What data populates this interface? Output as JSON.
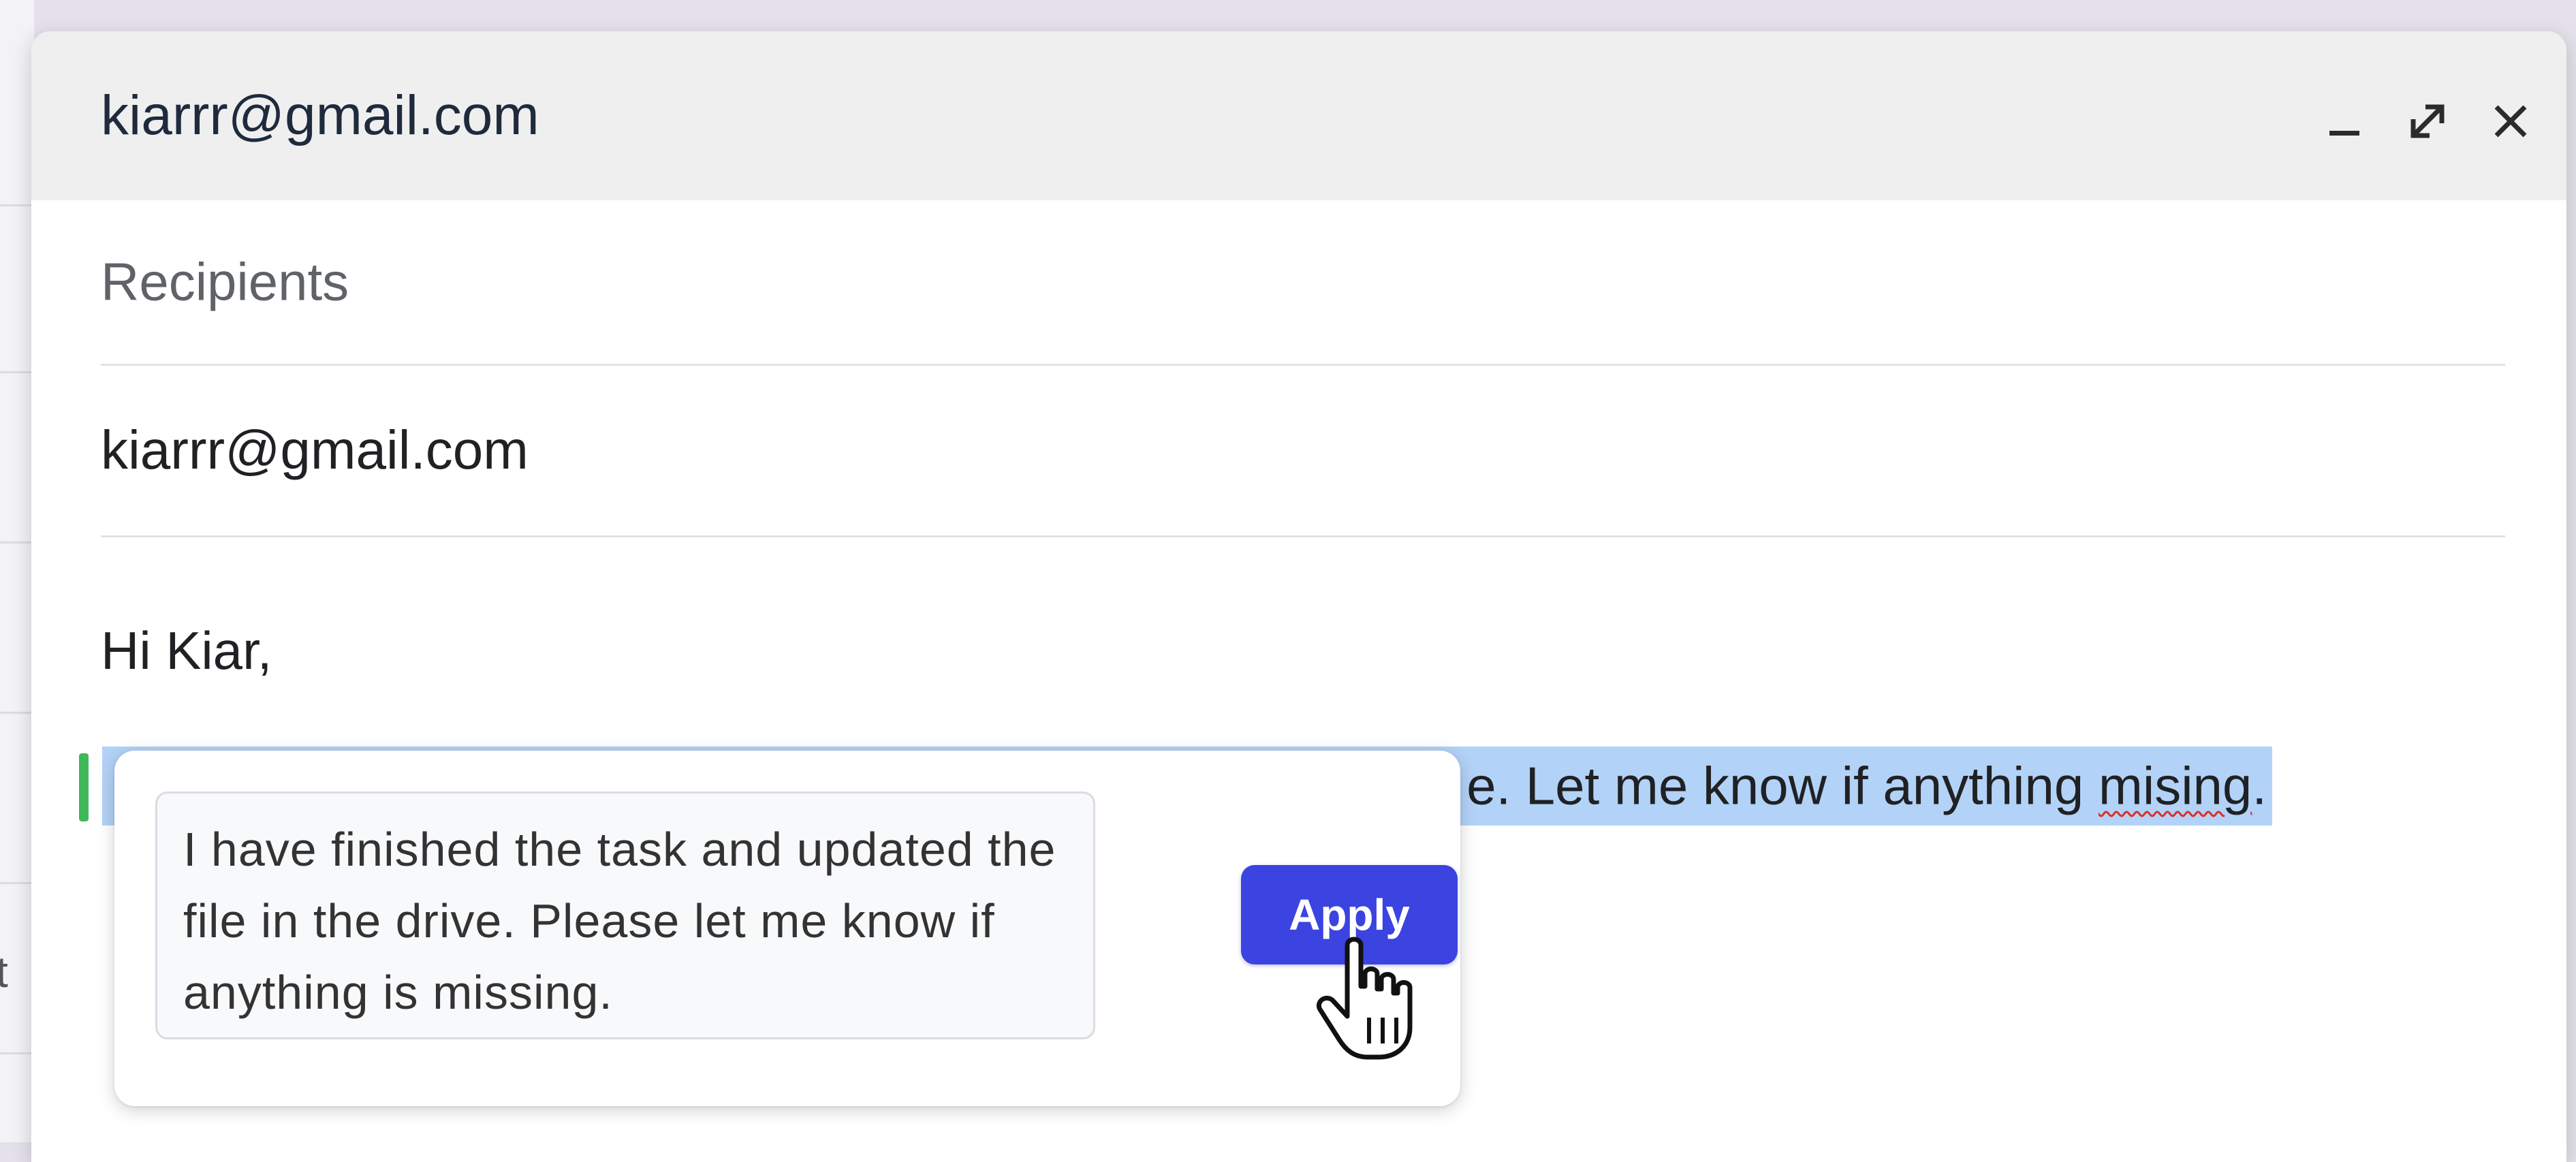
{
  "compose": {
    "header_title": "kiarrr@gmail.com",
    "controls": {
      "minimize_icon": "minimize-icon",
      "expand_icon": "expand-icon",
      "close_icon": "close-icon"
    },
    "recipients_placeholder": "Recipients",
    "to_value": "kiarrr@gmail.com",
    "body": {
      "greeting": "Hi Kiar,",
      "selected_text_visible": "e. Let me know if anything ",
      "misspelled_word": "mising",
      "selected_text_end": "."
    }
  },
  "rewrite_popup": {
    "suggestion": "I have finished the task and updated the file in the drive. Please let me know if anything is missing.",
    "apply_label": "Apply"
  },
  "background": {
    "left_fragment": "t"
  },
  "colors": {
    "accent": "#3b44e0",
    "selection": "#b3d2f7",
    "header_bg": "#efefef",
    "marker": "#3fb85a"
  }
}
